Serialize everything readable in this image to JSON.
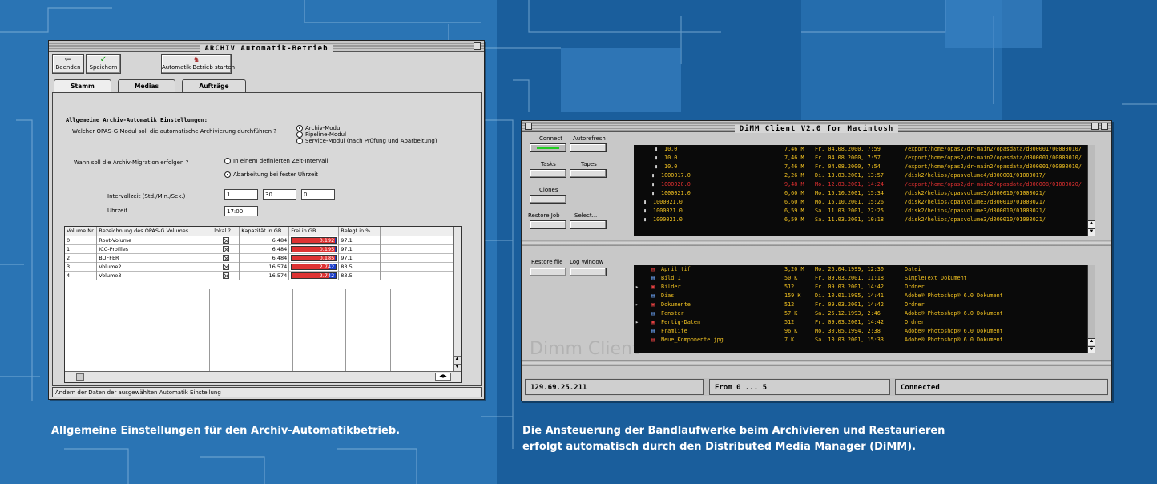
{
  "captions": {
    "left": "Allgemeine Einstellungen für den Archiv-Automatikbetrieb.",
    "right_line1": "Die Ansteuerung der Bandlaufwerke beim Archivieren und Restaurieren",
    "right_line2": "erfolgt automatisch durch den Distributed Media Manager (DiMM)."
  },
  "archiv": {
    "title": "ARCHIV Automatik-Betrieb",
    "toolbar": {
      "beenden": "Beenden",
      "speichern": "Speichern",
      "start": "Automatik-Betrieb starten"
    },
    "tabs": [
      "Stamm",
      "Medias",
      "Aufträge"
    ],
    "heading": "Allgemeine Archiv-Automatik Einstellungen:",
    "q1": "Welcher OPAS-G Modul soll die automatische Archivierung durchführen ?",
    "modul_options": [
      "Archiv-Modul",
      "Pipeline-Modul",
      "Service-Modul (nach Prüfung und Abarbeitung)"
    ],
    "q2": "Wann soll die Archiv-Migration erfolgen ?",
    "migration_options": [
      "In einem definierten Zeit-Intervall",
      "Abarbeitung bei fester Uhrzeit"
    ],
    "intervall_label": "Intervallzeit (Std./Min./Sek.)",
    "intervall_values": [
      "1",
      "30",
      "0"
    ],
    "uhrzeit_label": "Uhrzeit",
    "uhrzeit_value": "17:00",
    "columns": [
      "Volume Nr.",
      "Bezeichnung des OPAS-G Volumes",
      "lokal ?",
      "Kapazität in GB",
      "Frei in GB",
      "Belegt in %"
    ],
    "rows": [
      {
        "nr": "0",
        "name": "Root-Volume",
        "kap": "6.484",
        "frei": "0.192",
        "belegt": "97.1",
        "fill": 0.97
      },
      {
        "nr": "1",
        "name": "ICC-Profiles",
        "kap": "6.484",
        "frei": "0.195",
        "belegt": "97.1",
        "fill": 0.97
      },
      {
        "nr": "2",
        "name": "BUFFER",
        "kap": "6.484",
        "frei": "0.185",
        "belegt": "97.1",
        "fill": 0.97
      },
      {
        "nr": "3",
        "name": "Volume2",
        "kap": "16.574",
        "frei": "2.742",
        "belegt": "83.5",
        "fill": 0.835
      },
      {
        "nr": "4",
        "name": "Volume3",
        "kap": "16.574",
        "frei": "2.742",
        "belegt": "83.5",
        "fill": 0.835
      }
    ],
    "status": "Ändern der Daten der ausgewählten Automatik Einstellung"
  },
  "dimm": {
    "title": "DiMM Client V2.0  for Macintosh",
    "buttons": {
      "connect": "Connect",
      "autorefresh": "Autorefresh",
      "tasks": "Tasks",
      "tapes": "Tapes",
      "clones": "Clones",
      "restore_job": "Restore Job",
      "select": "Select...",
      "restore_file": "Restore file",
      "log_window": "Log Window"
    },
    "tape_rows": [
      {
        "id": "10.0",
        "size": "7,46 M",
        "date": "Fr. 04.08.2000, 7:59",
        "path": "/export/home/opas2/dr-main2/opasdata/d000001/00000010/",
        "color": "#f0c020"
      },
      {
        "id": "10.0",
        "size": "7,46 M",
        "date": "Fr. 04.08.2000, 7:57",
        "path": "/export/home/opas2/dr-main2/opasdata/d000001/00000010/",
        "color": "#f0c020"
      },
      {
        "id": "10.0",
        "size": "7,46 M",
        "date": "Fr. 04.08.2000, 7:54",
        "path": "/export/home/opas2/dr-main2/opasdata/d000001/00000010/",
        "color": "#f0c020"
      },
      {
        "id": "1000017.0",
        "size": "2,26 M",
        "date": "Di. 13.03.2001, 13:57",
        "path": "/disk2/helios/opasvolume4/d000001/01000017/",
        "color": "#f0c020"
      },
      {
        "id": "1000020.0",
        "size": "9,48 M",
        "date": "Mo. 12.03.2001, 14:24",
        "path": "/export/home/opas2/dr-main2/opasdata/d000008/01000020/",
        "color": "#e03030"
      },
      {
        "id": "1000021.0",
        "size": "6,60 M",
        "date": "Mo. 15.10.2001, 15:34",
        "path": "/disk2/helios/opasvolume3/d000010/01000021/",
        "color": "#f0c020"
      },
      {
        "id": "1000021.0",
        "size": "6,60 M",
        "date": "Mo. 15.10.2001, 15:26",
        "path": "/disk2/helios/opasvolume3/d000010/01000021/",
        "color": "#f0c020"
      },
      {
        "id": "1000021.0",
        "size": "6,59 M",
        "date": "Sa. 11.03.2001, 22:25",
        "path": "/disk2/helios/opasvolume3/d000010/01000021/",
        "color": "#f0c020"
      },
      {
        "id": "1000021.0",
        "size": "6,59 M",
        "date": "Sa. 11.03.2001, 10:18",
        "path": "/disk2/helios/opasvolume3/d000010/01000021/",
        "color": "#f0c020"
      }
    ],
    "file_rows": [
      {
        "name": "April.tif",
        "size": "3,20 M",
        "date": "Mo. 26.04.1999, 12:30",
        "kind": "Datei"
      },
      {
        "name": "Bild 1",
        "size": "50 K",
        "date": "Fr. 09.03.2001, 11:18",
        "kind": "SimpleText Dokument"
      },
      {
        "name": "Bilder",
        "size": "512",
        "date": "Fr. 09.03.2001, 14:42",
        "kind": "Ordner"
      },
      {
        "name": "Dias",
        "size": "159 K",
        "date": "Di. 10.01.1995, 14:41",
        "kind": "Adobe® Photoshop® 6.0 Dokument"
      },
      {
        "name": "Dokumente",
        "size": "512",
        "date": "Fr. 09.03.2001, 14:42",
        "kind": "Ordner"
      },
      {
        "name": "Fenster",
        "size": "57 K",
        "date": "Sa. 25.12.1993, 2:46",
        "kind": "Adobe® Photoshop® 6.0 Dokument"
      },
      {
        "name": "Fertig-Daten",
        "size": "512",
        "date": "Fr. 09.03.2001, 14:42",
        "kind": "Ordner"
      },
      {
        "name": "Framlife",
        "size": "96 K",
        "date": "Mo. 30.05.1994, 2:38",
        "kind": "Adobe® Photoshop® 6.0 Dokument"
      },
      {
        "name": "Neue_Komponente.jpg",
        "size": "7 K",
        "date": "Sa. 10.03.2001, 15:33",
        "kind": "Adobe® Photoshop® 6.0 Dokument"
      }
    ],
    "watermark": "Dimm Client",
    "status_ip": "129.69.25.211",
    "status_range": "From 0 ... 5",
    "status_conn": "Connected"
  },
  "colors": {
    "background": "#1e6aa8",
    "tape_text": "#f0c020",
    "tape_error": "#e03030"
  }
}
